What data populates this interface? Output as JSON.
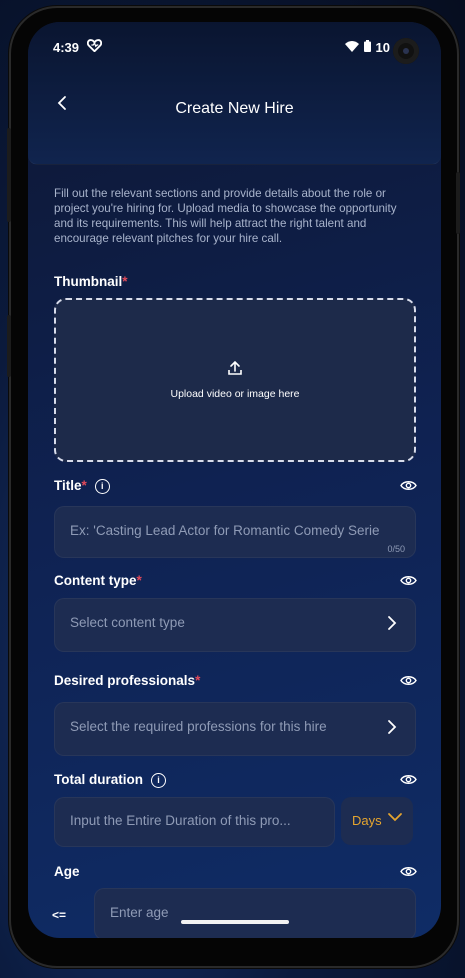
{
  "status_bar": {
    "time": "4:39",
    "battery": "10"
  },
  "header": {
    "title": "Create New Hire"
  },
  "intro_text": "Fill out the relevant sections and provide details about the role or project you're hiring for. Upload media to showcase the opportunity and its requirements. This will help attract the right talent and encourage relevant pitches for your hire call.",
  "thumbnail": {
    "label": "Thumbnail",
    "required_mark": "*",
    "upload_text": "Upload video or image here"
  },
  "title_field": {
    "label": "Title",
    "required_mark": "*",
    "placeholder": "Ex: 'Casting Lead Actor for Romantic Comedy Serie",
    "counter": "0/50"
  },
  "content_type": {
    "label": "Content type",
    "required_mark": "*",
    "placeholder": "Select content type"
  },
  "desired_professionals": {
    "label": "Desired professionals",
    "required_mark": "*",
    "placeholder": "Select the required professions for this hire"
  },
  "total_duration": {
    "label": "Total duration",
    "placeholder": "Input the Entire Duration of this pro...",
    "unit": "Days"
  },
  "age": {
    "label": "Age",
    "operator": "<=",
    "placeholder": "Enter age"
  },
  "colors": {
    "accent": "#e5a52f",
    "required": "#e24a5a"
  },
  "icons": [
    "heart-icon",
    "wifi-icon",
    "battery-icon",
    "back-chevron-icon",
    "upload-icon",
    "info-icon",
    "eye-icon",
    "chevron-right-icon",
    "chevron-down-icon"
  ]
}
